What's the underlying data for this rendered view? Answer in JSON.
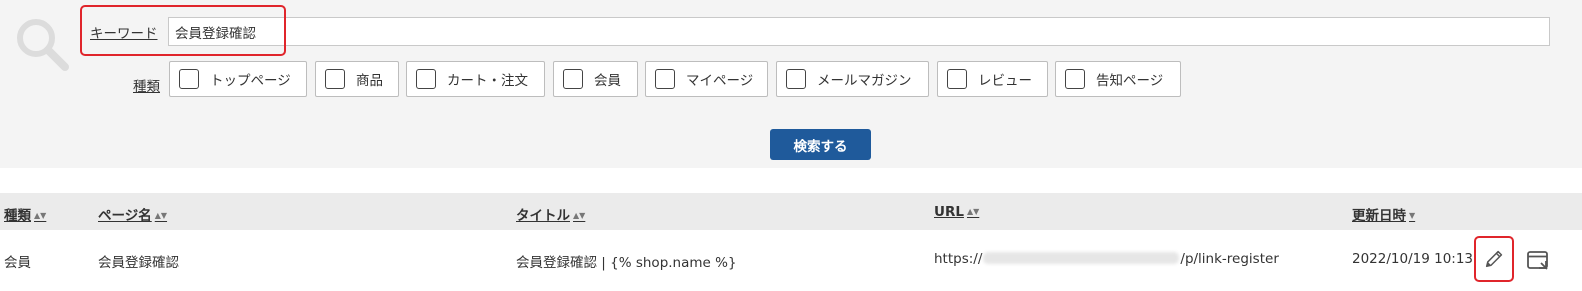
{
  "search": {
    "icon": "search-icon",
    "keyword_label": "キーワード",
    "keyword_value": "会員登録確認",
    "type_label": "種類",
    "types": [
      "トップページ",
      "商品",
      "カート・注文",
      "会員",
      "マイページ",
      "メールマガジン",
      "レビュー",
      "告知ページ"
    ],
    "submit_label": "検索する"
  },
  "table": {
    "headers": {
      "type": "種類",
      "page_name": "ページ名",
      "title": "タイトル",
      "url": "URL",
      "updated": "更新日時"
    },
    "rows": [
      {
        "type": "会員",
        "page_name": "会員登録確認",
        "title": "会員登録確認 | {% shop.name %}",
        "url_prefix": "https://",
        "url_suffix": "/p/link-register",
        "updated": "2022/10/19 10:13"
      }
    ],
    "row_actions": [
      "edit-icon",
      "preview-icon"
    ]
  },
  "colors": {
    "primary_button": "#1f5a9b",
    "highlight": "#e0252b",
    "panel_bg": "#f4f4f4",
    "header_bg": "#ebebeb"
  }
}
